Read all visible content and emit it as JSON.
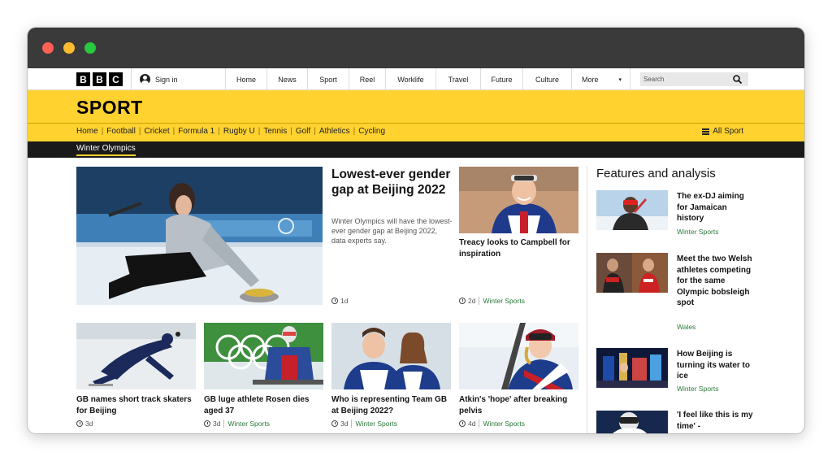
{
  "bbc_logo": [
    "B",
    "B",
    "C"
  ],
  "topbar": {
    "signin": "Sign in",
    "nav": [
      "Home",
      "News",
      "Sport",
      "Reel",
      "Worklife",
      "Travel",
      "Future",
      "Culture",
      "More"
    ],
    "search_placeholder": "Search"
  },
  "sport_header": {
    "title": "SPORT",
    "nav": [
      "Home",
      "Football",
      "Cricket",
      "Formula 1",
      "Rugby U",
      "Tennis",
      "Golf",
      "Athletics",
      "Cycling"
    ],
    "all_sport": "All Sport",
    "subnav_active": "Winter Olympics"
  },
  "lead": {
    "headline": "Lowest-ever gender gap at Beijing 2022",
    "summary": "Winter Olympics will have the lowest-ever gender gap at Beijing 2022, data experts say.",
    "time": "1d"
  },
  "second": {
    "headline": "Treacy looks to Campbell for inspiration",
    "time": "2d",
    "tag": "Winter Sports"
  },
  "grid": [
    {
      "headline": "GB names short track skaters for Beijing",
      "time": "3d",
      "tag": ""
    },
    {
      "headline": "GB luge athlete Rosen dies aged 37",
      "time": "3d",
      "tag": "Winter Sports"
    },
    {
      "headline": "Who is representing Team GB at Beijing 2022?",
      "time": "3d",
      "tag": "Winter Sports"
    },
    {
      "headline": "Atkin's 'hope' after breaking pelvis",
      "time": "4d",
      "tag": "Winter Sports"
    }
  ],
  "features": {
    "title": "Features and analysis",
    "items": [
      {
        "headline": "The ex-DJ aiming for Jamaican history",
        "tag": "Winter Sports"
      },
      {
        "headline": "Meet the two Welsh athletes competing for the same Olympic bobsleigh spot",
        "tag": "Wales"
      },
      {
        "headline": "How Beijing is turning its water to ice",
        "tag": "Winter Sports"
      },
      {
        "headline": "'I feel like this is my time' -",
        "tag": ""
      }
    ]
  },
  "colors": {
    "sport_yellow": "#ffd230",
    "tag_green": "#2a7a3a",
    "subnav_black": "#1a1a1a"
  }
}
